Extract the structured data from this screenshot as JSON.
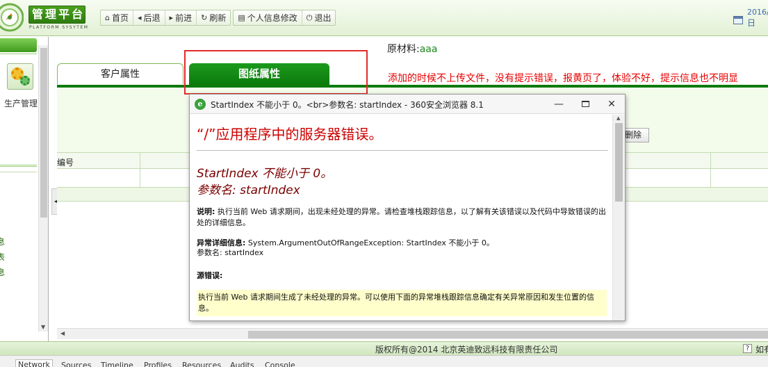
{
  "header": {
    "logo_title": "管理平台",
    "logo_subtitle": "PLATFORM SYSYTEM",
    "toolbar": [
      {
        "label": "首页",
        "icon": "home-icon",
        "glyph": "⌂"
      },
      {
        "label": "后退",
        "icon": "back-icon",
        "glyph": "◂"
      },
      {
        "label": "前进",
        "icon": "forward-icon",
        "glyph": "▸"
      },
      {
        "label": "刷新",
        "icon": "refresh-icon",
        "glyph": "↻"
      }
    ],
    "toolbar2": [
      {
        "label": "个人信息修改",
        "icon": "profile-icon",
        "glyph": "▤"
      },
      {
        "label": "退出",
        "icon": "power-icon",
        "glyph": "⏻"
      }
    ],
    "date_year": "2016/",
    "date_day": "日"
  },
  "sidebar": {
    "module_label": "生产管理",
    "links": [
      "息",
      "表",
      "息"
    ]
  },
  "main": {
    "material_label": "原材料:",
    "material_value": "aaa",
    "tabs": {
      "customer": "客户属性",
      "drawing": "图纸属性"
    },
    "note": "添加的时候不上传文件，没有提示错误，报黄页了，体验不好，提示信息也不明显",
    "delete_label": "删除",
    "grid_first_col": "编号"
  },
  "popup": {
    "window_title": "StartIndex 不能小于 0。<br>参数名: startIndex - 360安全浏览器 8.1",
    "error_title": "“/”应用程序中的服务器错误。",
    "error_message": "StartIndex 不能小于 0。",
    "error_param": "参数名: startIndex",
    "desc_label": "说明:",
    "desc_text": "执行当前 Web 请求期间，出现未经处理的异常。请检查堆栈跟踪信息，以了解有关该错误以及代码中导致错误的出处的详细信息。",
    "detail_label": "异常详细信息:",
    "detail_text": "System.ArgumentOutOfRangeException: StartIndex 不能小于 0。",
    "detail_param": "参数名: startIndex",
    "source_label": "源错误:",
    "source_box": "执行当前 Web 请求期间生成了未经处理的异常。可以使用下面的异常堆栈跟踪信息确定有关异常原因和发生位置的信息。"
  },
  "footer": {
    "copyright": "版权所有@2014 北京英迪致远科技有限责任公司",
    "help": "如有"
  },
  "devtools": {
    "tabs": [
      "Network",
      "Sources",
      "Timeline",
      "Profiles",
      "Resources",
      "Audits",
      "Console"
    ]
  },
  "colors": {
    "brand_green": "#0b7a0b",
    "note_red": "#e60000",
    "highlight_red": "#e22a2a",
    "error_title_red": "#cc0000",
    "error_box_yellow": "#ffffcc"
  }
}
